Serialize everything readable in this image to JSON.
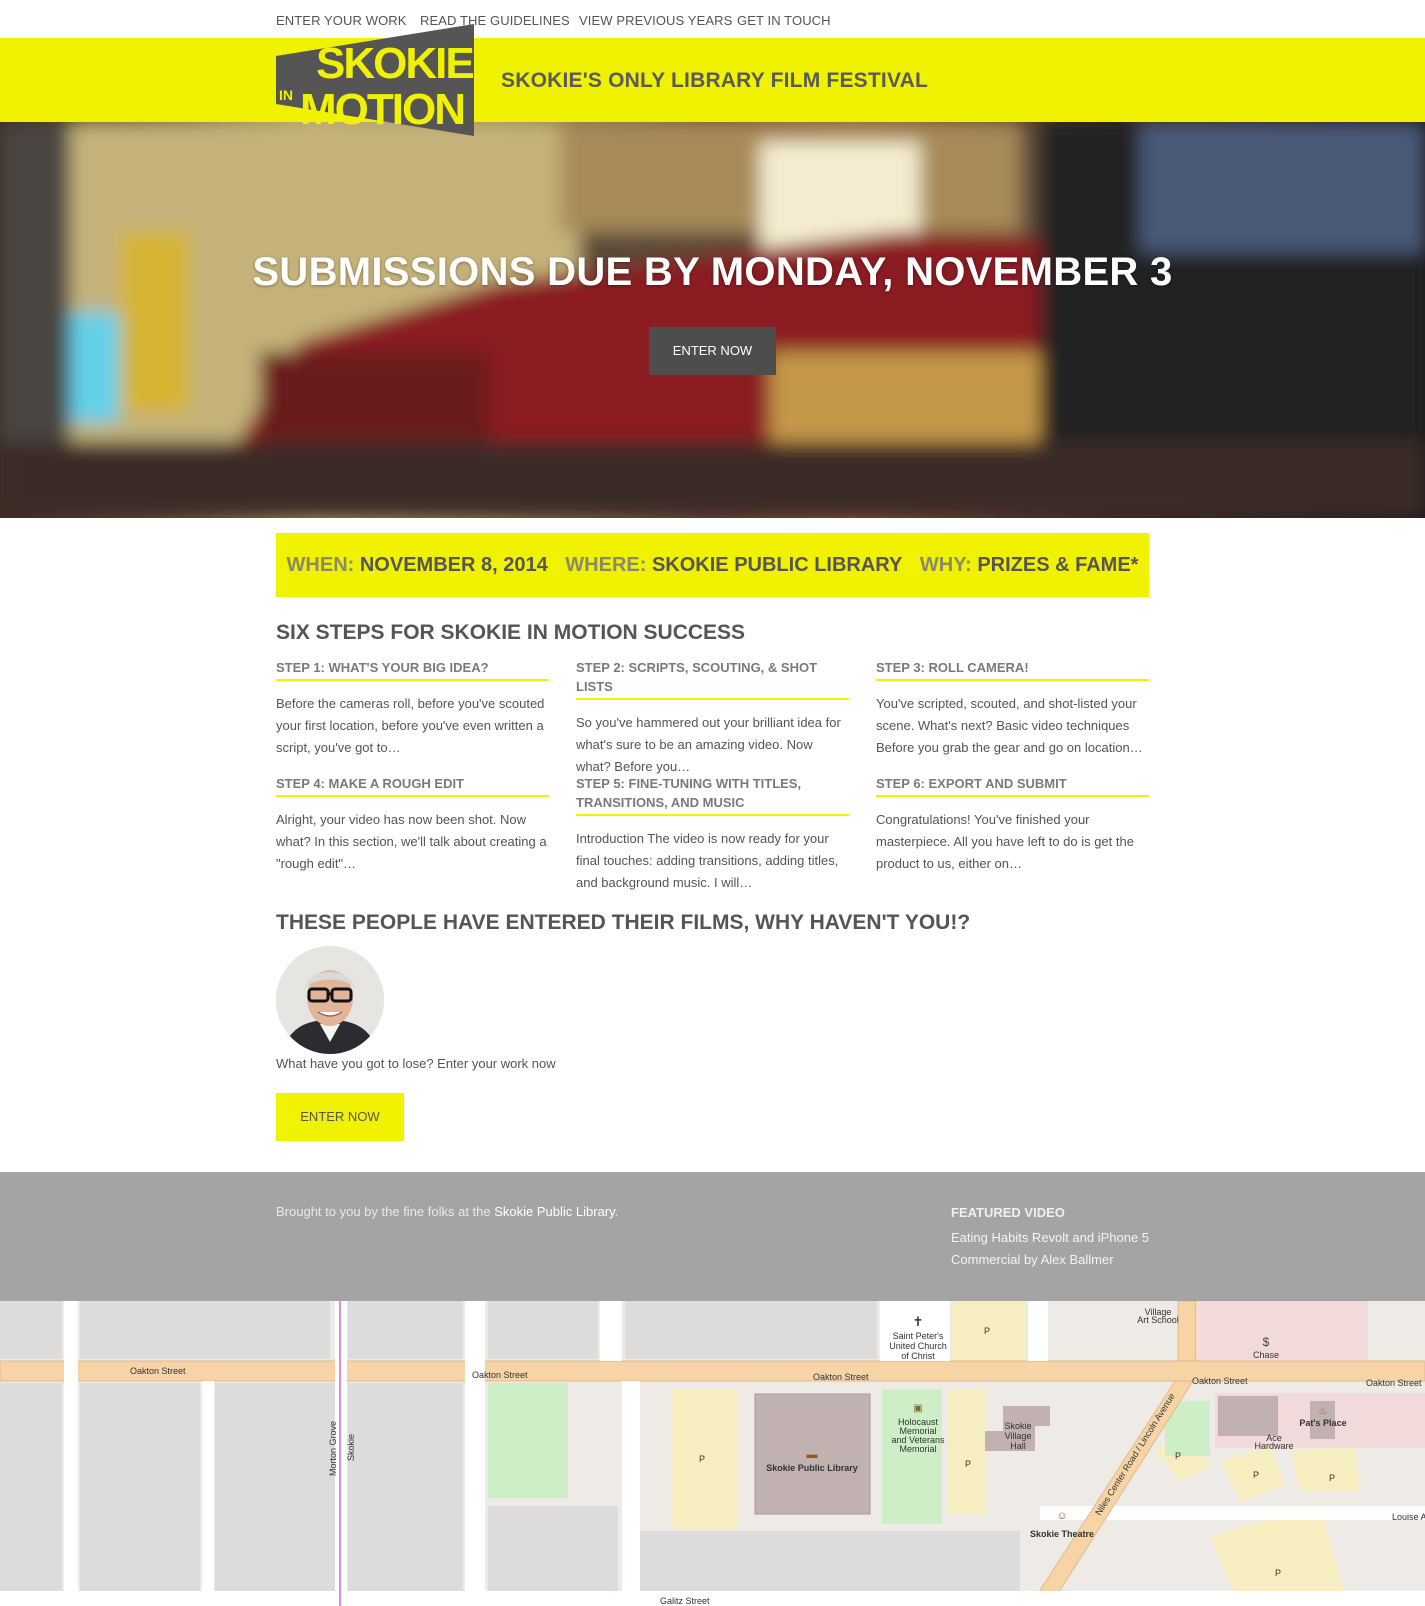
{
  "nav": {
    "items": [
      {
        "label": "ENTER YOUR WORK"
      },
      {
        "label": "READ THE GUIDELINES"
      },
      {
        "label": "VIEW PREVIOUS YEARS"
      },
      {
        "label": "GET IN TOUCH"
      }
    ]
  },
  "header": {
    "logo_text": "SKOKIE IN MOTION",
    "tagline": "SKOKIE'S ONLY LIBRARY FILM FESTIVAL",
    "brand_color": "#f0f200"
  },
  "hero": {
    "title": "SUBMISSIONS DUE BY MONDAY, NOVEMBER 3",
    "button_label": "ENTER NOW"
  },
  "info": {
    "when_label": "WHEN:",
    "when_value": "NOVEMBER 8, 2014",
    "where_label": "WHERE:",
    "where_value": "SKOKIE PUBLIC LIBRARY",
    "why_label": "WHY:",
    "why_value": "PRIZES & FAME*"
  },
  "steps_section": {
    "title": "SIX STEPS FOR SKOKIE IN MOTION SUCCESS",
    "steps": [
      {
        "title": "STEP 1: WHAT'S YOUR BIG IDEA?",
        "excerpt": "Before the cameras roll, before you've scouted your first location, before you've even written a script, you've got to…"
      },
      {
        "title": "STEP 2: SCRIPTS, SCOUTING, & SHOT LISTS",
        "excerpt": "So you've hammered out your brilliant idea for what's sure to be an amazing video. Now what? Before you…"
      },
      {
        "title": "STEP 3: ROLL CAMERA!",
        "excerpt": "You've scripted, scouted, and shot-listed your scene. What's next? Basic video techniques Before you grab the gear and go on location…"
      },
      {
        "title": "STEP 4: MAKE A ROUGH EDIT",
        "excerpt": "Alright, your video has now been shot. Now what? In this section, we'll talk about creating a \"rough edit\"…"
      },
      {
        "title": "STEP 5: FINE-TUNING WITH TITLES, TRANSITIONS, AND MUSIC",
        "excerpt": "Introduction The video is now ready for your final touches: adding transitions, adding titles, and background music. I will…"
      },
      {
        "title": "STEP 6: EXPORT AND SUBMIT",
        "excerpt": "Congratulations! You've finished your masterpiece. All you have left to do is get the product to us, either on…"
      }
    ]
  },
  "entrants": {
    "title": "THESE PEOPLE HAVE ENTERED THEIR FILMS, WHY HAVEN'T YOU!?",
    "prompt": "What have you got to lose? Enter your work now",
    "button_label": "ENTER NOW"
  },
  "footer": {
    "credit_prefix": "Brought to you by the fine folks at the ",
    "credit_link": "Skokie Public Library",
    "credit_suffix": ".",
    "featured_heading": "FEATURED VIDEO",
    "featured_link": "Eating Habits Revolt and iPhone 5 Commercial by Alex Ballmer"
  },
  "map": {
    "labels": {
      "oakton1": "Oakton Street",
      "oakton2": "Oakton Street",
      "oakton3": "Oakton Street",
      "oakton4": "Oakton Street",
      "oakton5": "Oakton Street",
      "church1": "Saint Peter's",
      "church2": "United Church",
      "church3": "of Christ",
      "village_art1": "Village",
      "village_art2": "Art School",
      "chase": "Chase",
      "library": "Skokie Public Library",
      "holocaust1": "Holocaust",
      "holocaust2": "Memorial",
      "holocaust3": "and Veterans",
      "holocaust4": "Memorial",
      "village_hall1": "Skokie",
      "village_hall2": "Village",
      "village_hall3": "Hall",
      "theatre": "Skokie Theatre",
      "niles": "Niles Center Road / Lincoln Avenue",
      "pats": "Pat's Place",
      "ace1": "Ace",
      "ace2": "Hardware",
      "louise": "Louise Avenue",
      "galitz": "Galitz Street",
      "morton": "Morton Grove",
      "skokie_rail": "Skokie",
      "parking": "P"
    }
  }
}
